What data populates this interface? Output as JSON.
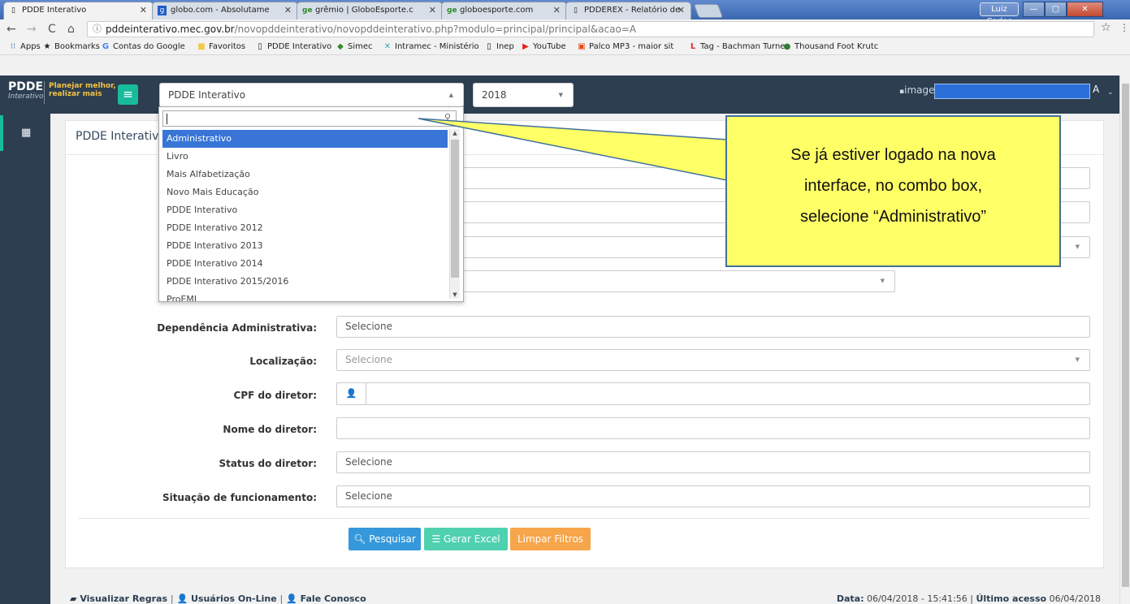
{
  "browser": {
    "tabs": [
      {
        "title": "PDDE Interativo",
        "icon": "📄",
        "active": true
      },
      {
        "title": "globo.com - Absolutame",
        "icon": "g"
      },
      {
        "title": "grêmio | GloboEsporte.c",
        "icon": "ge"
      },
      {
        "title": "globoesporte.com",
        "icon": "ge"
      },
      {
        "title": "PDDEREX - Relatório de",
        "icon": "📄"
      }
    ],
    "user_chip": "Luiz Carlos",
    "address": {
      "host": "pddeinterativo.mec.gov.br",
      "path": "/novopddeinterativo/novopddeinterativo.php?modulo=principal/principal&acao=A"
    },
    "bookmarks": [
      {
        "label": "Apps",
        "icon": "apps-icon"
      },
      {
        "label": "Bookmarks",
        "icon": "star-icon"
      },
      {
        "label": "Contas do Google",
        "icon": "google-icon"
      },
      {
        "label": "Favoritos",
        "icon": "folder-icon"
      },
      {
        "label": "PDDE Interativo",
        "icon": "page-icon"
      },
      {
        "label": "Simec",
        "icon": "flag-icon"
      },
      {
        "label": "Intramec - Ministério",
        "icon": "x-icon"
      },
      {
        "label": "Inep",
        "icon": "page-icon"
      },
      {
        "label": "YouTube",
        "icon": "youtube-icon"
      },
      {
        "label": "Palco MP3 - maior sit",
        "icon": "music-icon"
      },
      {
        "label": "Tag - Bachman Turne",
        "icon": "l-icon"
      },
      {
        "label": "Thousand Foot Krutc",
        "icon": "globe-icon"
      }
    ]
  },
  "header": {
    "logo_main": "PDDE",
    "logo_sub": "Interativo",
    "logo_tag1": "Planejar melhor,",
    "logo_tag2": "realizar mais",
    "module_select": "PDDE Interativo",
    "year_select": "2018",
    "image_alt": "image",
    "user_suffix": "A"
  },
  "panel": {
    "title": "PDDE Interativo"
  },
  "form": {
    "dependencia": {
      "label": "Dependência Administrativa:",
      "value": "Selecione"
    },
    "localizacao": {
      "label": "Localização:",
      "value": "Selecione"
    },
    "cpf": {
      "label": "CPF do diretor:",
      "value": ""
    },
    "nome": {
      "label": "Nome do diretor:",
      "value": ""
    },
    "status": {
      "label": "Status do diretor:",
      "value": "Selecione"
    },
    "situacao": {
      "label": "Situação de funcionamento:",
      "value": "Selecione"
    }
  },
  "buttons": {
    "pesquisar": "Pesquisar",
    "excel": "Gerar Excel",
    "limpar": "Limpar Filtros"
  },
  "dropdown": {
    "search_value": "",
    "options": [
      "Administrativo",
      "Livro",
      "Mais Alfabetização",
      "Novo Mais Educação",
      "PDDE Interativo",
      "PDDE Interativo 2012",
      "PDDE Interativo 2013",
      "PDDE Interativo 2014",
      "PDDE Interativo 2015/2016",
      "ProEMI"
    ],
    "highlighted": "Administrativo"
  },
  "callout": {
    "line1": "Se já estiver logado na nova",
    "line2": "interface, no combo box,",
    "line3": "selecione “Administrativo”"
  },
  "footer": {
    "links": [
      "Visualizar Regras",
      "Usuários On-Line",
      "Fale Conosco"
    ],
    "date_label": "Data:",
    "date_value": "06/04/2018 - 15:41:56",
    "last_label": "Último acesso",
    "last_value": "06/04/2018"
  },
  "colors": {
    "header_bg": "#2c3e50",
    "accent_green": "#18bc9c",
    "btn_primary": "#3498db",
    "btn_success": "#4fd1b0",
    "btn_warning": "#f7a54a",
    "highlight": "#3875d7",
    "callout_fill": "#ffff66"
  }
}
